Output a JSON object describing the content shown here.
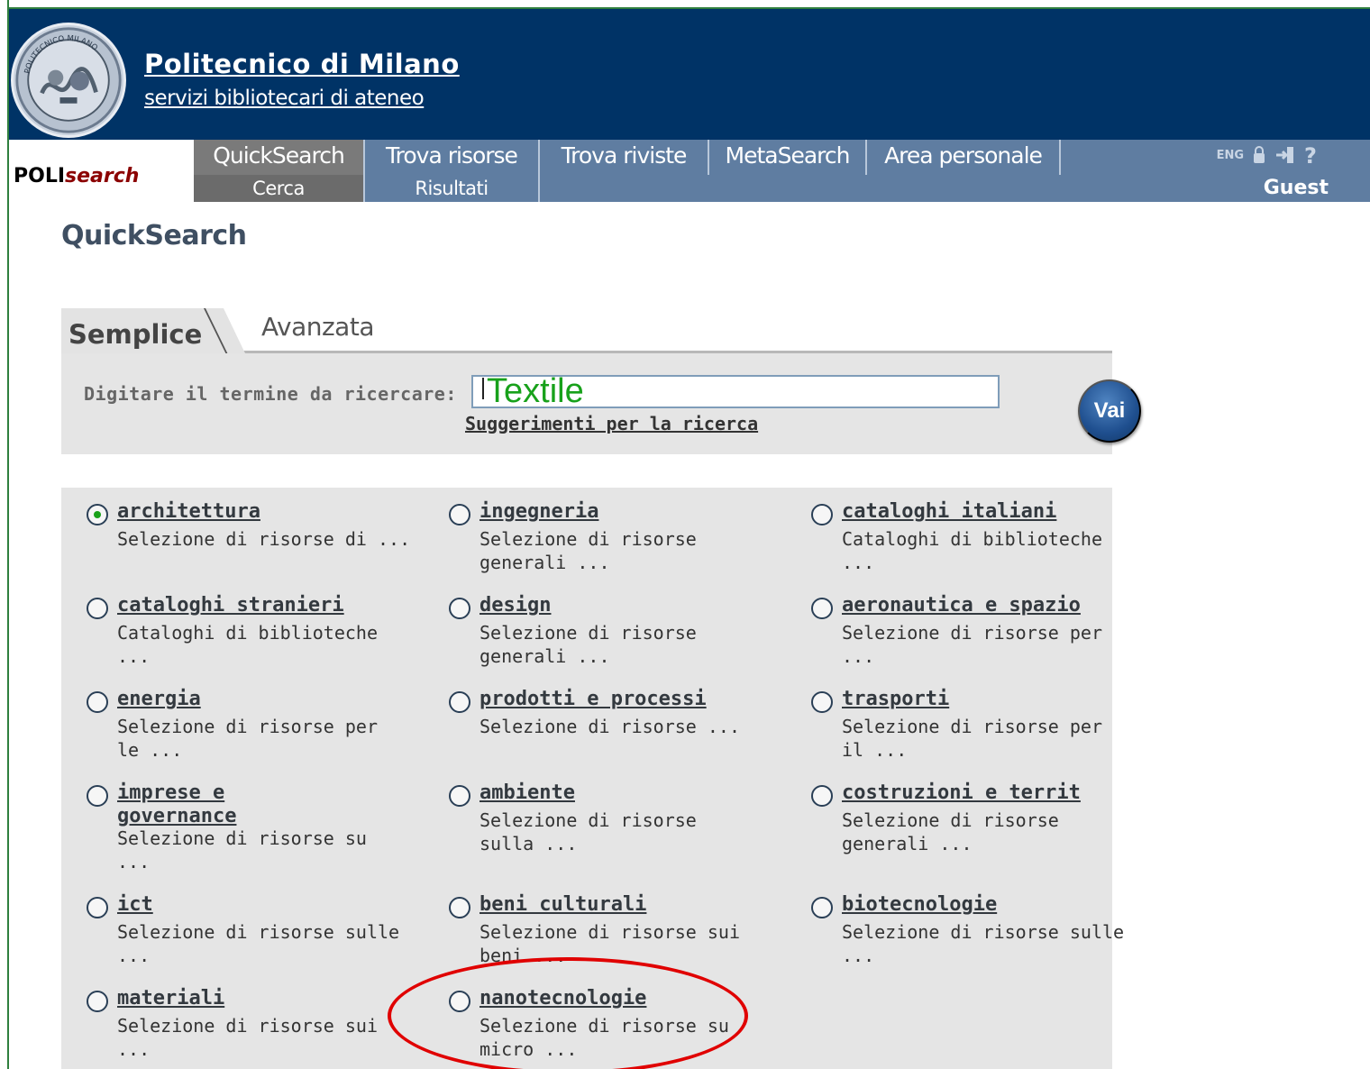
{
  "header": {
    "seal_name": "POLITECNICO MILANO",
    "title": "Politecnico di Milano",
    "subtitle": "servizi bibliotecari di ateneo"
  },
  "brand": {
    "prefix": "POLI",
    "suffix": "search"
  },
  "nav": {
    "tabs": [
      {
        "label": "QuickSearch",
        "active": true
      },
      {
        "label": "Trova risorse"
      },
      {
        "label": "Trova riviste"
      },
      {
        "label": "MetaSearch"
      },
      {
        "label": "Area personale"
      }
    ],
    "subtabs": [
      {
        "label": "Cerca",
        "active": true
      },
      {
        "label": "Risultati"
      }
    ],
    "lang": "ENG",
    "icons": [
      "lock-icon",
      "logout-icon",
      "help-icon"
    ],
    "user": "Guest"
  },
  "page": {
    "title": "QuickSearch",
    "tab_simple": "Semplice",
    "tab_advanced": "Avanzata"
  },
  "search": {
    "label": "Digitare il termine da ricercare:",
    "value": "Textile",
    "tips": "Suggerimenti per la ricerca",
    "button": "Vai"
  },
  "categories": [
    {
      "title": "architettura",
      "desc": [
        "Selezione di risorse di ..."
      ],
      "checked": true
    },
    {
      "title": "ingegneria",
      "desc": [
        "Selezione di risorse",
        "generali ..."
      ]
    },
    {
      "title": "cataloghi italiani",
      "desc": [
        "Cataloghi di biblioteche",
        "..."
      ]
    },
    {
      "title": "cataloghi stranieri",
      "desc": [
        "Cataloghi di biblioteche",
        "..."
      ]
    },
    {
      "title": "design",
      "desc": [
        "Selezione di risorse",
        "generali ..."
      ]
    },
    {
      "title": "aeronautica e spazio",
      "desc": [
        "Selezione di risorse per",
        "..."
      ]
    },
    {
      "title": "energia",
      "desc": [
        "Selezione di risorse per",
        "le ..."
      ]
    },
    {
      "title": "prodotti e processi",
      "desc": [
        "Selezione di risorse ..."
      ]
    },
    {
      "title": "trasporti",
      "desc": [
        "Selezione di risorse per",
        "il ..."
      ]
    },
    {
      "title": "imprese e governance",
      "desc": [
        "Selezione di risorse su",
        "..."
      ]
    },
    {
      "title": "ambiente",
      "desc": [
        "Selezione di risorse",
        "sulla ..."
      ]
    },
    {
      "title": "costruzioni e territ",
      "desc": [
        "Selezione di risorse",
        "generali ..."
      ]
    },
    {
      "title": "ict",
      "desc": [
        "Selezione di risorse sulle",
        "..."
      ]
    },
    {
      "title": "beni culturali",
      "desc": [
        "Selezione di risorse sui",
        "beni ..."
      ]
    },
    {
      "title": "biotecnologie",
      "desc": [
        "Selezione di risorse sulle",
        "..."
      ]
    },
    {
      "title": "materiali",
      "desc": [
        "Selezione di risorse sui",
        "..."
      ]
    },
    {
      "title": "nanotecnologie",
      "desc": [
        "Selezione di risorse su",
        "micro ..."
      ]
    }
  ],
  "colors": {
    "header_bg": "#003366",
    "nav_bg": "#5f7da1",
    "active_tab_bg": "#7a7a7a",
    "search_text": "#18a11b",
    "annotation": "#e00000"
  }
}
